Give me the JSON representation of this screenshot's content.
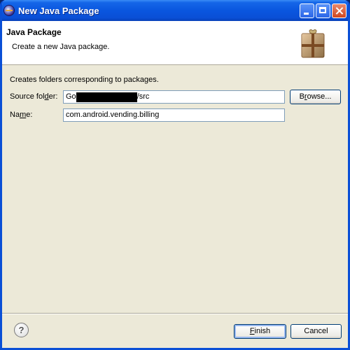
{
  "window": {
    "title": "New Java Package",
    "icon": "eclipse-icon"
  },
  "header": {
    "title": "Java Package",
    "description": "Create a new Java package.",
    "icon": "package-box-icon"
  },
  "form": {
    "intro": "Creates folders corresponding to packages.",
    "source_folder_label": "Source folder:",
    "source_folder_prefix": "Go",
    "source_folder_suffix": "/src",
    "name_label": "Name:",
    "name_value": "com.android.vending.billing"
  },
  "buttons": {
    "browse": "Browse...",
    "finish": "Finish",
    "cancel": "Cancel",
    "help": "?"
  },
  "colors": {
    "titlebar": "#0a4fd6",
    "dialog_bg": "#ece9d8",
    "header_bg": "#ffffff"
  }
}
